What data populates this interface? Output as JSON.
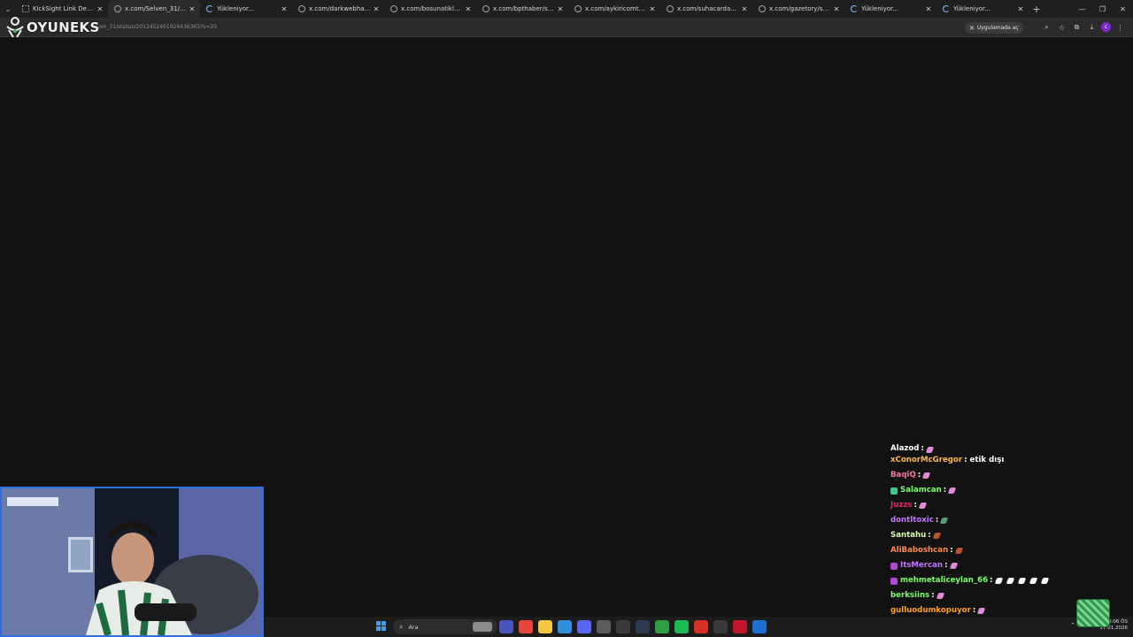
{
  "browser": {
    "tabs": [
      {
        "title": "KickSight Link Detector",
        "favicon": "grid",
        "active": false
      },
      {
        "title": "x.com/Selven_31/status/2012452...",
        "favicon": "circle",
        "active": true
      },
      {
        "title": "Yükleniyor...",
        "favicon": "spin",
        "active": false
      },
      {
        "title": "x.com/darkwebhaber/status/...",
        "favicon": "circle",
        "active": false
      },
      {
        "title": "x.com/bosunatiklama/status/...",
        "favicon": "circle",
        "active": false
      },
      {
        "title": "x.com/bpthaber/status/20...",
        "favicon": "circle",
        "active": false
      },
      {
        "title": "x.com/aykiricomtr/status/...",
        "favicon": "circle",
        "active": false
      },
      {
        "title": "x.com/suhacardakli/status/...",
        "favicon": "circle",
        "active": false
      },
      {
        "title": "x.com/gazetory/status/20...",
        "favicon": "circle",
        "active": false
      },
      {
        "title": "Yükleniyor...",
        "favicon": "spin",
        "active": false
      },
      {
        "title": "Yükleniyor...",
        "favicon": "spin",
        "active": false
      }
    ],
    "url_visible": "elven_31/status/2012452401924436365?s=20",
    "open_in_app": "Uygulamada aç",
    "profile_initial": "c"
  },
  "overlay": {
    "logo_text": "OYUNEKS"
  },
  "chat": [
    {
      "user": "Alazod",
      "color": "#ffffff",
      "text": "",
      "emotes": [
        "#e08ad8"
      ],
      "badge": null
    },
    {
      "user": "xConorMcGregor",
      "color": "#ffb84d",
      "text": "etik dışı",
      "emotes": [],
      "badge": null
    },
    {
      "user": "BaqiQ",
      "color": "#ff6fa5",
      "text": "",
      "emotes": [
        "#e08ad8"
      ],
      "badge": null
    },
    {
      "user": "Salamcan",
      "color": "#7cff6b",
      "text": "",
      "emotes": [
        "#e08ad8"
      ],
      "badge": "#3ec98a"
    },
    {
      "user": "Juzzs",
      "color": "#e0245e",
      "text": "",
      "emotes": [
        "#e08ad8"
      ],
      "badge": null
    },
    {
      "user": "dontltoxic",
      "color": "#c474ff",
      "text": "",
      "emotes": [
        "#5a9a6f"
      ],
      "badge": null
    },
    {
      "user": "Santahu",
      "color": "#d6ffb0",
      "text": "",
      "emotes": [
        "#b5552f"
      ],
      "badge": null
    },
    {
      "user": "AliBaboshcan",
      "color": "#ff8a4d",
      "text": "",
      "emotes": [
        "#b5552f"
      ],
      "badge": null
    },
    {
      "user": "ItsMercan",
      "color": "#c474ff",
      "text": "",
      "emotes": [
        "#e08ad8"
      ],
      "badge": "#b04ad6"
    },
    {
      "user": "mehmetaliceylan_66",
      "color": "#7cff6b",
      "text": "",
      "emotes": [
        "#ffffff",
        "#ffffff",
        "#ffffff",
        "#ffffff",
        "#ffffff"
      ],
      "badge": "#b04ad6"
    },
    {
      "user": "berksiins",
      "color": "#7cff6b",
      "text": "",
      "emotes": [
        "#e08ad8"
      ],
      "badge": null
    },
    {
      "user": "gulluodumkopuyor",
      "color": "#ff9f1a",
      "text": "",
      "emotes": [
        "#e08ad8"
      ],
      "badge": null
    }
  ],
  "taskbar": {
    "search_label": "Ara",
    "time": "10:06 ÖS",
    "date": "17.01.2026",
    "apps": [
      {
        "name": "teams-icon",
        "color": "#4b53bc"
      },
      {
        "name": "chrome-icon",
        "color": "#e8453c"
      },
      {
        "name": "file-explorer-icon",
        "color": "#f4c542"
      },
      {
        "name": "edge-icon",
        "color": "#2f8fdd"
      },
      {
        "name": "discord-icon",
        "color": "#5865f2"
      },
      {
        "name": "app-icon",
        "color": "#5c5c5c"
      },
      {
        "name": "download-app-icon",
        "color": "#3a3a3a"
      },
      {
        "name": "steam-icon",
        "color": "#2a3a4f"
      },
      {
        "name": "xbox-icon",
        "color": "#2f9e44"
      },
      {
        "name": "spotify-icon",
        "color": "#1db954"
      },
      {
        "name": "chrome-alt-icon",
        "color": "#d93025"
      },
      {
        "name": "obs-icon",
        "color": "#3a3a3a"
      },
      {
        "name": "opera-icon",
        "color": "#c4162a"
      },
      {
        "name": "store-icon",
        "color": "#1f6fd1"
      }
    ]
  }
}
